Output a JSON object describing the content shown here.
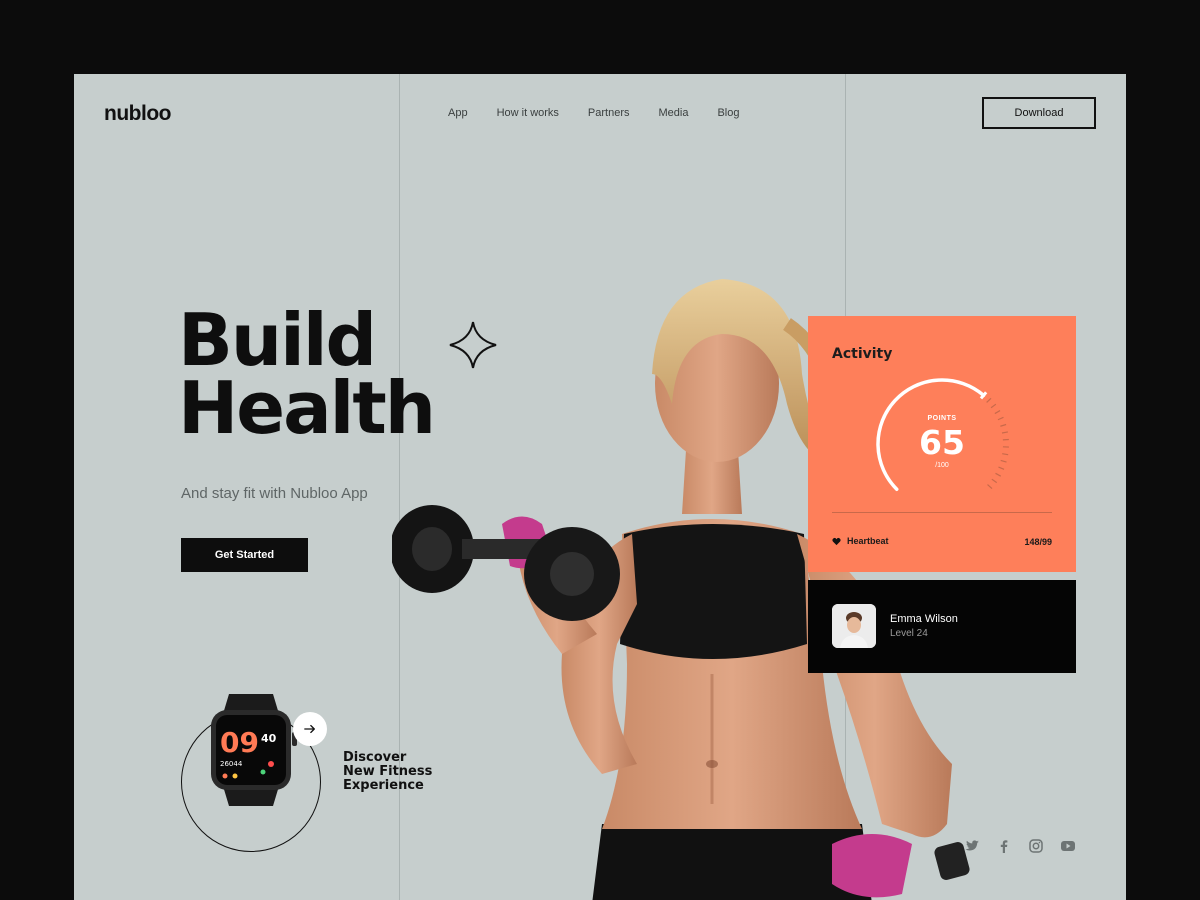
{
  "brand": {
    "logo": "nubloo"
  },
  "nav": {
    "items": [
      "App",
      "How it works",
      "Partners",
      "Media",
      "Blog"
    ]
  },
  "header": {
    "download_label": "Download"
  },
  "hero": {
    "title_line1": "Build",
    "title_line2": "Health",
    "subtitle": "And stay fit with Nubloo App",
    "cta_label": "Get Started"
  },
  "discover": {
    "line1": "Discover",
    "line2": "New Fitness",
    "line3": "Experience",
    "watch_time_hours": "09",
    "watch_time_minutes": "40",
    "watch_steps": "26044"
  },
  "activity": {
    "title": "Activity",
    "points_label": "POINTS",
    "points_value": "65",
    "points_max": "/100",
    "gauge_fraction": 0.65,
    "heartbeat_label": "Heartbeat",
    "heartbeat_value": "148/99"
  },
  "user": {
    "name": "Emma Wilson",
    "level": "Level 24"
  },
  "socials": [
    "twitter-icon",
    "facebook-icon",
    "instagram-icon",
    "youtube-icon"
  ],
  "colors": {
    "accent": "#fe7f5a",
    "background": "#c6cecd",
    "dark": "#0d0d0d"
  }
}
